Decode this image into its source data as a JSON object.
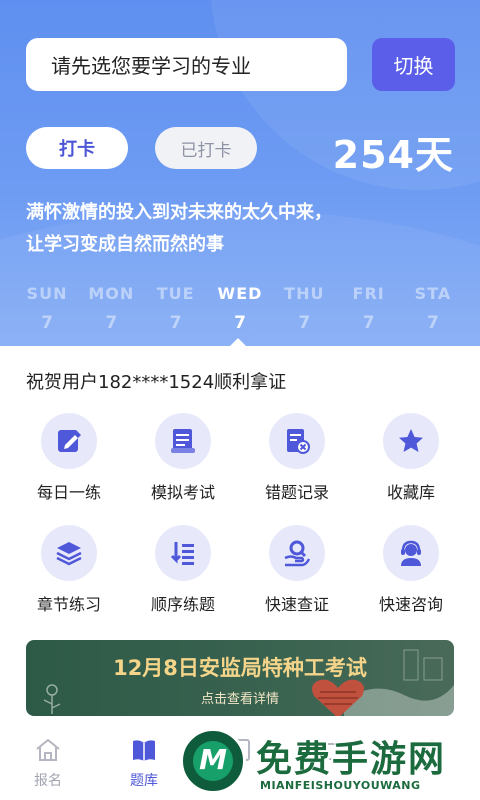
{
  "header": {
    "search_placeholder": "请先选您要学习的专业",
    "switch_label": "切换",
    "checkin_label": "打卡",
    "checked_label": "已打卡",
    "days_count": "254天",
    "motto_line1": "满怀激情的投入到对未来的太久中来，",
    "motto_line2": "让学习变成自然而然的事"
  },
  "week": [
    {
      "name": "SUN",
      "date": "7"
    },
    {
      "name": "MON",
      "date": "7"
    },
    {
      "name": "TUE",
      "date": "7"
    },
    {
      "name": "WED",
      "date": "7"
    },
    {
      "name": "THU",
      "date": "7"
    },
    {
      "name": "FRI",
      "date": "7"
    },
    {
      "name": "STA",
      "date": "7"
    }
  ],
  "congrats_text": "祝贺用户182****1524顺利拿证",
  "features": [
    {
      "label": "每日一练",
      "icon": "edit-icon"
    },
    {
      "label": "模拟考试",
      "icon": "exam-paper-icon"
    },
    {
      "label": "错题记录",
      "icon": "error-record-icon"
    },
    {
      "label": "收藏库",
      "icon": "star-icon"
    },
    {
      "label": "章节练习",
      "icon": "layers-icon"
    },
    {
      "label": "顺序练题",
      "icon": "sequence-list-icon"
    },
    {
      "label": "快速查证",
      "icon": "search-hand-icon"
    },
    {
      "label": "快速咨询",
      "icon": "customer-service-icon"
    }
  ],
  "banner": {
    "title": "12月8日安监局特种工考试",
    "subtitle": "点击查看详情"
  },
  "nav": [
    {
      "label": "报名",
      "icon": "home-icon"
    },
    {
      "label": "题库",
      "icon": "book-icon"
    },
    {
      "label": "",
      "icon": "study-icon"
    },
    {
      "label": "",
      "icon": "recruit-icon"
    },
    {
      "label": "",
      "icon": "profile-icon"
    }
  ],
  "watermark": {
    "title": "免费手游网",
    "subtitle": "MIANFEISHOUYOUWANG",
    "logo_letter": "M"
  },
  "colors": {
    "accent": "#5b5ee8",
    "hero": "#6e9cf3",
    "icon_bg": "#e7e9fb",
    "banner_bg": "#2d5a47",
    "banner_title": "#f5d58a"
  }
}
